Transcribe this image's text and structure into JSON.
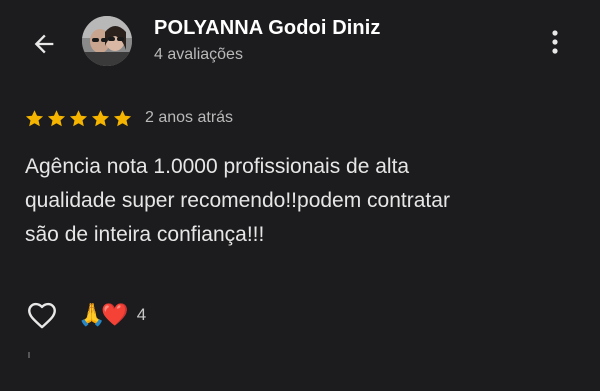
{
  "header": {
    "back_icon": "arrow-left-icon",
    "reviewer_name": "POLYANNA Godoi Diniz",
    "review_count": "4 avaliações",
    "more_icon": "more-vert-icon"
  },
  "review": {
    "rating": 5,
    "max_rating": 5,
    "star_color": "#f5b400",
    "date": "2 anos atrás",
    "text": "Agência nota 1.0000 profissionais de alta\nqualidade super recomendo!!podem contratar\nsão de inteira confiança!!!"
  },
  "actions": {
    "like_icon": "heart-outline-icon",
    "reactions": "🙏❤️",
    "reaction_count": "4"
  },
  "colors": {
    "background": "#1c1c1e",
    "primary_text": "#ffffff",
    "secondary_text": "#b9b9b9"
  }
}
